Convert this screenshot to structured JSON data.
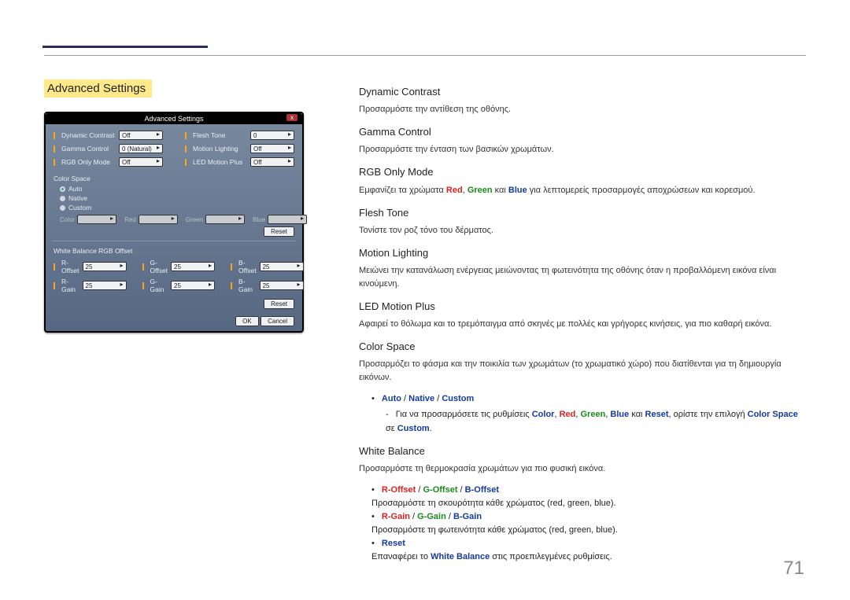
{
  "page_number": "71",
  "section_title": "Advanced Settings",
  "osd": {
    "title": "Advanced Settings",
    "close": "x",
    "colA": [
      {
        "label": "Dynamic Contrast",
        "value": "Off"
      },
      {
        "label": "Gamma Control",
        "value": "0 (Natural)"
      },
      {
        "label": "RGB Only Mode",
        "value": "Off"
      }
    ],
    "colB": [
      {
        "label": "Flesh Tone",
        "value": "0"
      },
      {
        "label": "Motion Lighting",
        "value": "Off"
      },
      {
        "label": "LED Motion Plus",
        "value": "Off"
      }
    ],
    "color_space_label": "Color Space",
    "radios": [
      "Auto",
      "Native",
      "Custom"
    ],
    "color_row": {
      "color_label": "Color",
      "r": "Red",
      "g": "Green",
      "b": "Blue"
    },
    "reset_btn": "Reset",
    "wb_title": "White Balance RGB Offset",
    "wb": {
      "rOffset": {
        "label": "R-Offset",
        "value": "25"
      },
      "gOffset": {
        "label": "G-Offset",
        "value": "25"
      },
      "bOffset": {
        "label": "B-Offset",
        "value": "25"
      },
      "rGain": {
        "label": "R-Gain",
        "value": "25"
      },
      "gGain": {
        "label": "G-Gain",
        "value": "25"
      },
      "bGain": {
        "label": "B-Gain",
        "value": "25"
      }
    },
    "ok": "OK",
    "cancel": "Cancel"
  },
  "content": {
    "dynamic_contrast": {
      "h": "Dynamic Contrast",
      "p": "Προσαρμόστε την αντίθεση της οθόνης."
    },
    "gamma_control": {
      "h": "Gamma Control",
      "p": "Προσαρμόστε την ένταση των βασικών χρωμάτων."
    },
    "rgb_only": {
      "h": "RGB Only Mode",
      "p_pre": "Εμφανίζει τα χρώματα ",
      "red": "Red",
      "comma1": ", ",
      "green": "Green",
      "and": " και ",
      "blue": "Blue",
      "p_post": " για λεπτομερείς προσαρμογές αποχρώσεων και κορεσμού."
    },
    "flesh_tone": {
      "h": "Flesh Tone",
      "p": "Τονίστε τον ροζ τόνο του δέρματος."
    },
    "motion_lighting": {
      "h": "Motion Lighting",
      "p": "Μειώνει την κατανάλωση ενέργειας μειώνοντας τη φωτεινότητα της οθόνης όταν η προβαλλόμενη εικόνα είναι κινούμενη."
    },
    "led_motion_plus": {
      "h": "LED Motion Plus",
      "p": "Αφαιρεί το θόλωμα και το τρεμόπαιγμα από σκηνές με πολλές και γρήγορες κινήσεις, για πιο καθαρή εικόνα."
    },
    "color_space": {
      "h": "Color Space",
      "p": "Προσαρμόζει το φάσμα και την ποικιλία των χρωμάτων (το χρωματικό χώρο) που διατίθενται για τη δημιουργία εικόνων.",
      "bul_auto": "Auto",
      "bul_sep": " / ",
      "bul_native": "Native",
      "bul_custom": "Custom",
      "sub_pre": "Για να προσαρμόσετε τις ρυθμίσεις ",
      "sub_color": "Color",
      "c1": ", ",
      "sub_red": "Red",
      "c2": ", ",
      "sub_green": "Green",
      "c3": ", ",
      "sub_blue": "Blue",
      "sub_and": " και ",
      "sub_reset": "Reset",
      "sub_mid": ", ορίστε την επιλογή ",
      "sub_cs": "Color Space",
      "sub_mid2": " σε ",
      "sub_custom": "Custom",
      "sub_end": "."
    },
    "white_balance": {
      "h": "White Balance",
      "p": "Προσαρμόστε τη θερμοκρασία χρωμάτων για πιο φυσική εικόνα.",
      "bul1_r": "R-Offset",
      "sep": " / ",
      "bul1_g": "G-Offset",
      "bul1_b": "B-Offset",
      "bul1_p": "Προσαρμόστε τη σκουρότητα κάθε χρώματος (red, green, blue).",
      "bul2_r": "R-Gain",
      "bul2_g": "G-Gain",
      "bul2_b": "B-Gain",
      "bul2_p": "Προσαρμόστε τη φωτεινότητα κάθε χρώματος (red, green, blue).",
      "bul3": "Reset",
      "bul3_p_pre": "Επαναφέρει το ",
      "bul3_wb": "White Balance",
      "bul3_p_post": " στις προεπιλεγμένες ρυθμίσεις."
    }
  }
}
